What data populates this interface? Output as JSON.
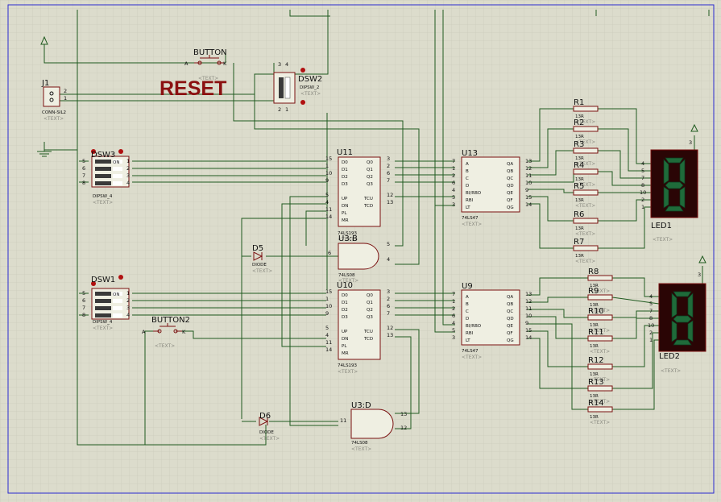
{
  "title_text": "RESET",
  "placeholder": "<TEXT>",
  "terminals": [
    "power-top-left",
    "ground-left",
    "power-led1",
    "power-led2"
  ],
  "connector": {
    "ref": "J1",
    "value": "CONN-SIL2",
    "pins": [
      "2",
      "1"
    ]
  },
  "switches": [
    {
      "ref": "DSW3",
      "value": "DIPSW_4",
      "left_pins": [
        "5",
        "6",
        "7",
        "8"
      ],
      "right_pins": [
        "1",
        "2",
        "3",
        "4"
      ],
      "inner": [
        "ON"
      ]
    },
    {
      "ref": "DSW1",
      "value": "DIPSW_4",
      "left_pins": [
        "5",
        "6",
        "7",
        "8"
      ],
      "right_pins": [
        "1",
        "2",
        "3",
        "4"
      ],
      "inner": [
        "ON"
      ]
    },
    {
      "ref": "DSW2",
      "value": "DIPSW_2",
      "pins": [
        "3",
        "4",
        "2",
        "1"
      ],
      "inner": [
        "ON"
      ]
    }
  ],
  "buttons": [
    {
      "ref": "BUTTON",
      "a": "A",
      "k": "K"
    },
    {
      "ref": "BUTTON2",
      "a": "A",
      "k": "K"
    }
  ],
  "counters": [
    {
      "ref": "U11",
      "value": "74LS193",
      "left": [
        [
          "15",
          "D0"
        ],
        [
          "1",
          "D1"
        ],
        [
          "10",
          "D2"
        ],
        [
          "9",
          "D3"
        ],
        [
          "5",
          "UP"
        ],
        [
          "4",
          "DN"
        ],
        [
          "11",
          "PL"
        ],
        [
          "14",
          "MR"
        ]
      ],
      "right": [
        [
          "3",
          "Q0"
        ],
        [
          "2",
          "Q1"
        ],
        [
          "6",
          "Q2"
        ],
        [
          "7",
          "Q3"
        ],
        [
          "12",
          "TCU"
        ],
        [
          "13",
          "TCD"
        ]
      ]
    },
    {
      "ref": "U10",
      "value": "74LS193",
      "left": [
        [
          "15",
          "D0"
        ],
        [
          "1",
          "D1"
        ],
        [
          "10",
          "D2"
        ],
        [
          "9",
          "D3"
        ],
        [
          "5",
          "UP"
        ],
        [
          "4",
          "DN"
        ],
        [
          "11",
          "PL"
        ],
        [
          "14",
          "MR"
        ]
      ],
      "right": [
        [
          "3",
          "Q0"
        ],
        [
          "2",
          "Q1"
        ],
        [
          "6",
          "Q2"
        ],
        [
          "7",
          "Q3"
        ],
        [
          "12",
          "TCU"
        ],
        [
          "13",
          "TCD"
        ]
      ]
    }
  ],
  "decoders": [
    {
      "ref": "U13",
      "value": "74LS47",
      "left": [
        [
          "7",
          "A"
        ],
        [
          "1",
          "B"
        ],
        [
          "2",
          "C"
        ],
        [
          "6",
          "D"
        ],
        [
          "4",
          "BI/RBO"
        ],
        [
          "5",
          "RBI"
        ],
        [
          "3",
          "LT"
        ]
      ],
      "right": [
        [
          "13",
          "QA"
        ],
        [
          "12",
          "QB"
        ],
        [
          "11",
          "QC"
        ],
        [
          "10",
          "QD"
        ],
        [
          "9",
          "QE"
        ],
        [
          "15",
          "QF"
        ],
        [
          "14",
          "QG"
        ]
      ]
    },
    {
      "ref": "U9",
      "value": "74LS47",
      "left": [
        [
          "7",
          "A"
        ],
        [
          "1",
          "B"
        ],
        [
          "2",
          "C"
        ],
        [
          "6",
          "D"
        ],
        [
          "4",
          "BI/RBO"
        ],
        [
          "5",
          "RBI"
        ],
        [
          "3",
          "LT"
        ]
      ],
      "right": [
        [
          "13",
          "QA"
        ],
        [
          "12",
          "QB"
        ],
        [
          "11",
          "QC"
        ],
        [
          "10",
          "QD"
        ],
        [
          "9",
          "QE"
        ],
        [
          "15",
          "QF"
        ],
        [
          "14",
          "QG"
        ]
      ]
    }
  ],
  "gates": [
    {
      "ref": "U3:B",
      "value": "74LS08",
      "in": [
        "5",
        "4"
      ],
      "out": "6"
    },
    {
      "ref": "U3:D",
      "value": "74LS08",
      "in": [
        "13",
        "12"
      ],
      "out": "11"
    }
  ],
  "diodes": [
    {
      "ref": "D5",
      "value": "DIODE"
    },
    {
      "ref": "D6",
      "value": "DIODE"
    }
  ],
  "resistors": [
    {
      "ref": "R1",
      "value": "13R"
    },
    {
      "ref": "R2",
      "value": "13R"
    },
    {
      "ref": "R3",
      "value": "13R"
    },
    {
      "ref": "R4",
      "value": "13R"
    },
    {
      "ref": "R5",
      "value": "13R"
    },
    {
      "ref": "R6",
      "value": "13R"
    },
    {
      "ref": "R7",
      "value": "13R"
    },
    {
      "ref": "R8",
      "value": "13R"
    },
    {
      "ref": "R9",
      "value": "13R"
    },
    {
      "ref": "R10",
      "value": "13R"
    },
    {
      "ref": "R11",
      "value": "13R"
    },
    {
      "ref": "R12",
      "value": "13R"
    },
    {
      "ref": "R13",
      "value": "13R"
    },
    {
      "ref": "R14",
      "value": "13R"
    }
  ],
  "displays": [
    {
      "ref": "LED1",
      "digit": "8",
      "pins": [
        "4",
        "5",
        "7",
        "8",
        "10",
        "2",
        "1"
      ],
      "common": "3"
    },
    {
      "ref": "LED2",
      "digit": "8",
      "pins": [
        "4",
        "5",
        "7",
        "8",
        "10",
        "2",
        "1"
      ],
      "common": "3"
    }
  ],
  "colors": {
    "background": "#dcdccc",
    "grid": "#c6c6b6",
    "wire": "#1f5a1f",
    "body": "#7a1010",
    "reset": "#8b1010",
    "led_off": "#2a0505",
    "led_on": "#1f6b3a",
    "border": "#2a2ad0"
  }
}
